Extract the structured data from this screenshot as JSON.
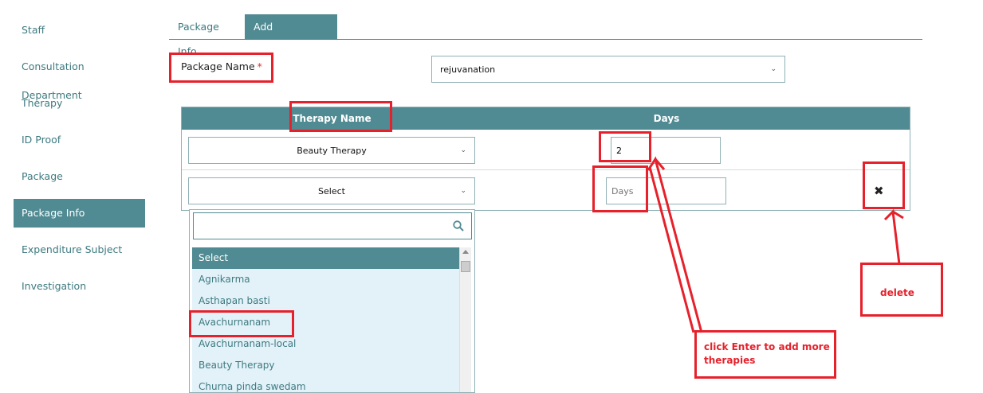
{
  "sidebar": {
    "items": [
      {
        "label": "Staff"
      },
      {
        "label": "Consultation Department"
      },
      {
        "label": "Therapy"
      },
      {
        "label": "ID Proof"
      },
      {
        "label": "Package"
      },
      {
        "label": "Package Info"
      },
      {
        "label": "Expenditure Subject"
      },
      {
        "label": "Investigation"
      }
    ],
    "active_index": 5
  },
  "tabs": [
    {
      "label": "Package Info"
    },
    {
      "label": "Add PackageInfo"
    }
  ],
  "form": {
    "package_name_label": "Package Name",
    "required_mark": "*",
    "package_value": "rejuvanation"
  },
  "table": {
    "col_therapy": "Therapy Name",
    "col_days": "Days",
    "rows": [
      {
        "therapy": "Beauty Therapy",
        "days": "2"
      },
      {
        "therapy": "Select",
        "days": "",
        "days_placeholder": "Days"
      }
    ],
    "delete_symbol": "✖"
  },
  "dropdown": {
    "search_value": "",
    "options": [
      "Select",
      "Agnikarma",
      "Asthapan basti",
      "Avachurnanam",
      "Avachurnanam-local",
      "Beauty Therapy",
      "Churna pinda swedam"
    ],
    "selected_index": 0
  },
  "annotations": {
    "delete_note": "delete",
    "enter_note": "click Enter to add more therapies"
  },
  "colors": {
    "accent": "#508a92",
    "annotation": "#e6212b",
    "dropdown_bg": "#e3f2f9"
  }
}
